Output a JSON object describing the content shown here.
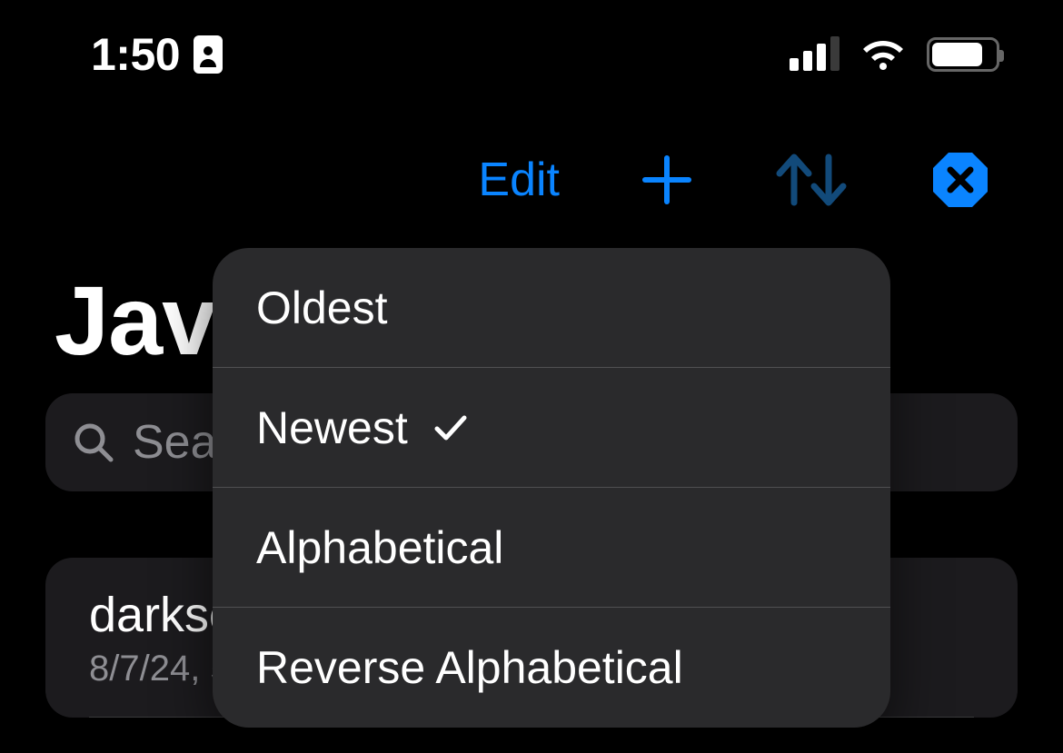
{
  "status_bar": {
    "time": "1:50"
  },
  "toolbar": {
    "edit_label": "Edit"
  },
  "page": {
    "title_truncated": "Java"
  },
  "search": {
    "placeholder_truncated": "Sea"
  },
  "list": {
    "items": [
      {
        "title_truncated": "darksc",
        "subtitle_truncated": "8/7/24, 5"
      }
    ]
  },
  "sort_menu": {
    "options": [
      {
        "label": "Oldest",
        "selected": false
      },
      {
        "label": "Newest",
        "selected": true
      },
      {
        "label": "Alphabetical",
        "selected": false
      },
      {
        "label": "Reverse Alphabetical",
        "selected": false
      }
    ]
  }
}
